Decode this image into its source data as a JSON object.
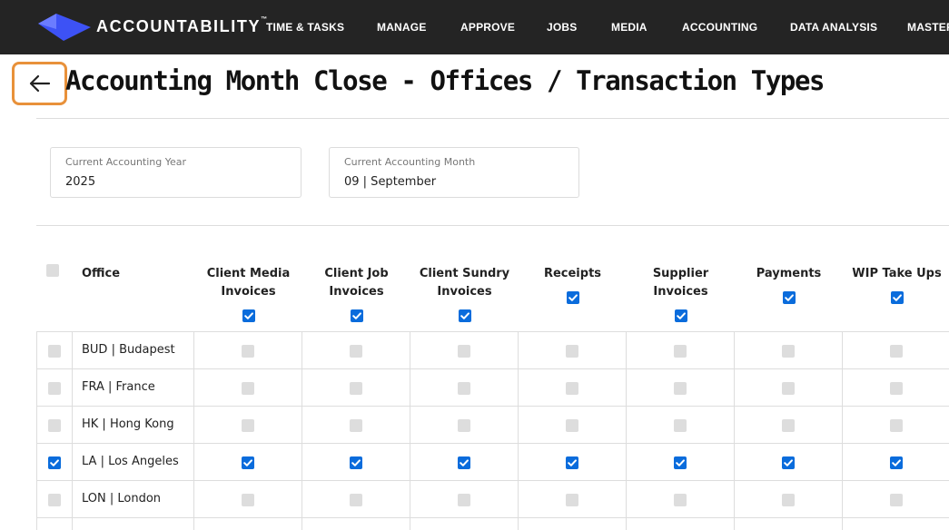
{
  "nav": {
    "brand": "ACCOUNTABILITY",
    "trademark": "™",
    "items": [
      "TIME & TASKS",
      "MANAGE",
      "APPROVE",
      "JOBS",
      "MEDIA",
      "ACCOUNTING",
      "DATA ANALYSIS",
      "MASTER"
    ]
  },
  "header": {
    "title": "Accounting Month Close - Offices / Transaction Types"
  },
  "fields": {
    "year_label": "Current Accounting Year",
    "year_value": "2025",
    "month_label": "Current Accounting Month",
    "month_value": "09 | September"
  },
  "table": {
    "office_header": "Office",
    "columns": [
      {
        "line1": "Client Media",
        "line2": "Invoices",
        "checked": true
      },
      {
        "line1": "Client Job",
        "line2": "Invoices",
        "checked": true
      },
      {
        "line1": "Client Sundry",
        "line2": "Invoices",
        "checked": true
      },
      {
        "line1": "Receipts",
        "line2": "",
        "checked": true
      },
      {
        "line1": "Supplier",
        "line2": "Invoices",
        "checked": true
      },
      {
        "line1": "Payments",
        "line2": "",
        "checked": true
      },
      {
        "line1": "WIP Take Ups",
        "line2": "",
        "checked": true
      }
    ],
    "rows": [
      {
        "office": "BUD | Budapest",
        "selected": false,
        "values": [
          false,
          false,
          false,
          false,
          false,
          false,
          false
        ]
      },
      {
        "office": "FRA | France",
        "selected": false,
        "values": [
          false,
          false,
          false,
          false,
          false,
          false,
          false
        ]
      },
      {
        "office": "HK | Hong Kong",
        "selected": false,
        "values": [
          false,
          false,
          false,
          false,
          false,
          false,
          false
        ]
      },
      {
        "office": "LA | Los Angeles",
        "selected": true,
        "values": [
          true,
          true,
          true,
          true,
          true,
          true,
          true
        ]
      },
      {
        "office": "LON | London",
        "selected": false,
        "values": [
          false,
          false,
          false,
          false,
          false,
          false,
          false
        ]
      },
      {
        "office": "",
        "selected": false,
        "values": [
          false,
          false,
          false,
          false,
          false,
          false,
          false
        ]
      }
    ]
  },
  "colors": {
    "accent": "#0a6cdc",
    "highlight": "#e8913a",
    "topbar": "#242424",
    "logo": "#3d52f5"
  },
  "icons": {
    "back": "arrow-left-icon",
    "logo": "diamond-logo-icon",
    "check": "checkmark-icon"
  }
}
